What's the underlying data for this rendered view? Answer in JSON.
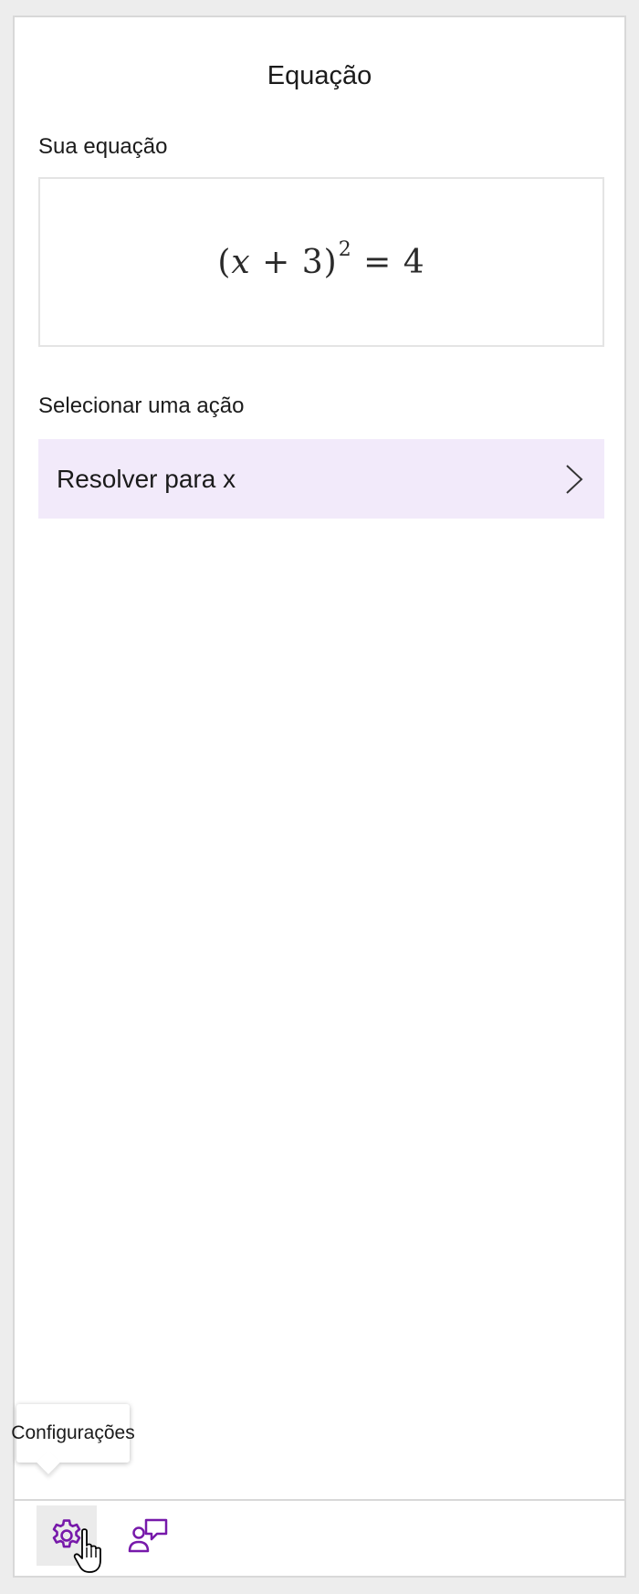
{
  "pane": {
    "title": "Equação"
  },
  "equation_section": {
    "label": "Sua equação",
    "lhs_open": "(",
    "lhs_var": "x",
    "lhs_plus": " + 3)",
    "exponent": "2",
    "rhs": " = 4"
  },
  "action_section": {
    "label": "Selecionar uma ação",
    "selected_action": "Resolver para x"
  },
  "footer": {
    "settings_tooltip": "Configurações"
  },
  "colors": {
    "accent": "#7719aa",
    "action_background": "#f2eafa"
  },
  "icons": [
    "settings-icon",
    "feedback-icon",
    "chevron-right-icon",
    "hand-cursor-icon"
  ]
}
